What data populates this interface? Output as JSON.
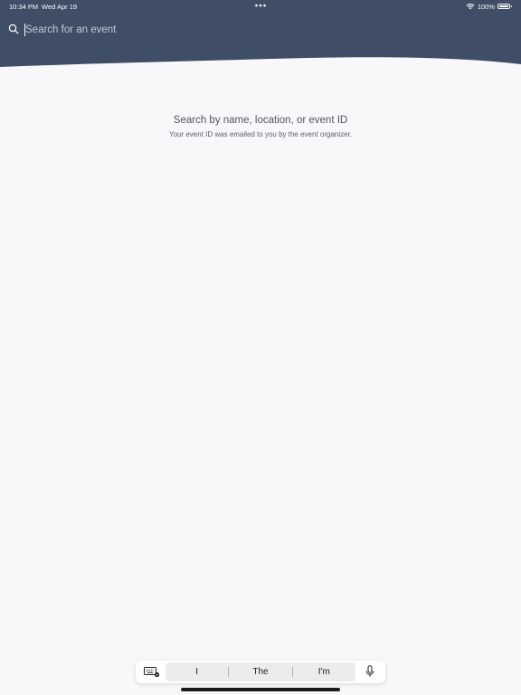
{
  "status_bar": {
    "time": "10:34 PM",
    "date": "Wed Apr 19",
    "battery": "100%",
    "wifi_icon": "wifi-icon",
    "battery_icon": "battery-icon"
  },
  "search": {
    "placeholder": "Search for an event",
    "value": "",
    "icon": "search-icon"
  },
  "empty_state": {
    "title": "Search by name, location, or event ID",
    "subtitle": "Your event ID was emailed to you by the event organizer."
  },
  "keyboard_bar": {
    "suggestions": [
      "I",
      "The",
      "I'm"
    ],
    "keyboard_icon": "keyboard-icon",
    "mic_icon": "microphone-icon"
  },
  "colors": {
    "header": "#3f4d67",
    "background": "#f8f8fa",
    "title_text": "#50535c"
  }
}
